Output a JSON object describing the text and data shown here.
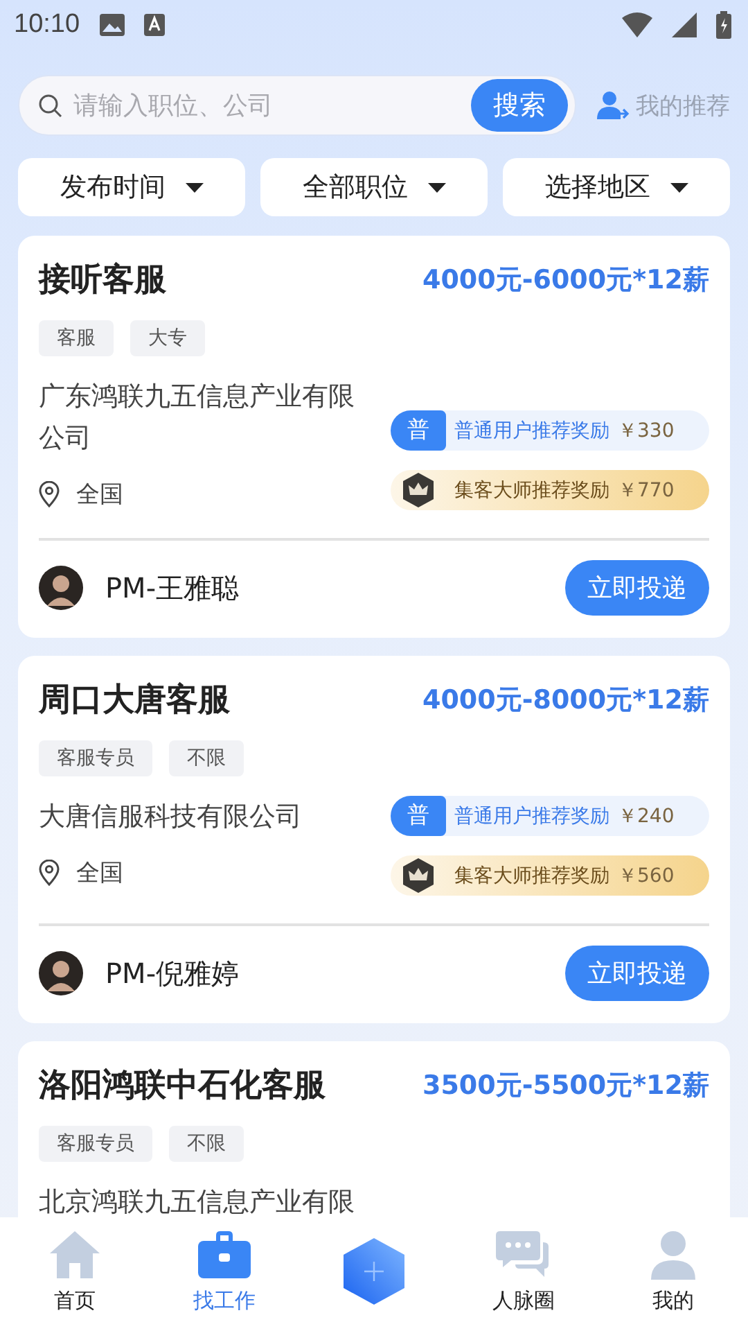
{
  "status_bar": {
    "time": "10:10"
  },
  "search": {
    "placeholder": "请输入职位、公司",
    "button": "搜索",
    "recommend": "我的推荐"
  },
  "filters": [
    {
      "label": "发布时间"
    },
    {
      "label": "全部职位"
    },
    {
      "label": "选择地区"
    }
  ],
  "jobs": [
    {
      "title": "接听客服",
      "salary": "4000元-6000元*12薪",
      "tags": [
        "客服",
        "大专"
      ],
      "company": "广东鸿联九五信息产业有限公司",
      "location": "全国",
      "rewards": [
        {
          "kind": "normal",
          "badge": "普",
          "text": "普通用户推荐奖励",
          "amount": "￥330"
        },
        {
          "kind": "master",
          "text": "集客大师推荐奖励",
          "amount": "￥770"
        }
      ],
      "recruiter": "PM-王雅聪",
      "apply": "立即投递"
    },
    {
      "title": "周口大唐客服",
      "salary": "4000元-8000元*12薪",
      "tags": [
        "客服专员",
        "不限"
      ],
      "company": "大唐信服科技有限公司",
      "location": "全国",
      "rewards": [
        {
          "kind": "normal",
          "badge": "普",
          "text": "普通用户推荐奖励",
          "amount": "￥240"
        },
        {
          "kind": "master",
          "text": "集客大师推荐奖励",
          "amount": "￥560"
        }
      ],
      "recruiter": "PM-倪雅婷",
      "apply": "立即投递"
    },
    {
      "title": "洛阳鸿联中石化客服",
      "salary": "3500元-5500元*12薪",
      "tags": [
        "客服专员",
        "不限"
      ],
      "company": "北京鸿联九五信息产业有限"
    }
  ],
  "nav": [
    {
      "kind": "home",
      "label": "首页",
      "selected": false
    },
    {
      "kind": "job",
      "label": "找工作",
      "selected": true
    },
    {
      "kind": "plus"
    },
    {
      "kind": "chat",
      "label": "人脉圈",
      "selected": false
    },
    {
      "kind": "me",
      "label": "我的",
      "selected": false
    }
  ]
}
